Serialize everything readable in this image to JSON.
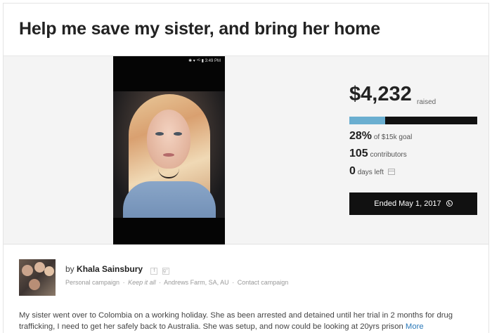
{
  "campaign": {
    "title": "Help me save my sister, and bring her home"
  },
  "phone": {
    "status_text": "✱ ▾ ⁴ᴳ ▮ 3:49 PM"
  },
  "stats": {
    "raised_amount": "$4,232",
    "raised_label": "raised",
    "progress_fraction": 0.28,
    "percent": "28%",
    "percent_label": "of $15k goal",
    "contributors": "105",
    "contributors_label": "contributors",
    "days_left": "0",
    "days_left_label": "days left",
    "ended_label": "Ended May 1, 2017",
    "progress_color": "#6aaed0"
  },
  "organizer": {
    "by": "by",
    "name": "Khala Sainsbury",
    "facebook_icon": "f",
    "google_icon": "g⁺",
    "campaign_type": "Personal campaign",
    "keep_it_all": "Keep it all",
    "location": "Andrews Farm, SA, AU",
    "contact": "Contact campaign"
  },
  "story": {
    "text": "My sister went over to Colombia on a working holiday. She as been arrested and detained until her trial in 2 months for drug trafficking, I need to get her safely back to Australia. She was setup, and now could be looking at 20yrs prison",
    "more_label": "More"
  }
}
